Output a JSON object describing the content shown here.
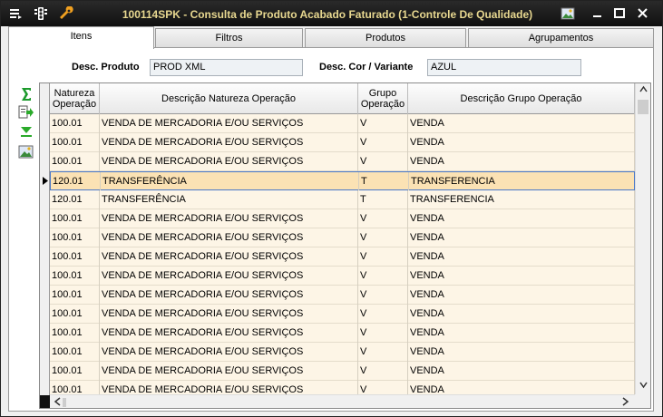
{
  "window": {
    "title": "100114SPK - Consulta de Produto Acabado Faturado (1-Controle De Qualidade)"
  },
  "tabs": [
    {
      "label": "Itens",
      "active": true
    },
    {
      "label": "Filtros",
      "active": false
    },
    {
      "label": "Produtos",
      "active": false
    },
    {
      "label": "Agrupamentos",
      "active": false
    }
  ],
  "filters": {
    "desc_produto_label": "Desc. Produto",
    "desc_produto_value": "PROD XML",
    "desc_cor_label": "Desc. Cor / Variante",
    "desc_cor_value": "AZUL"
  },
  "grid": {
    "columns": [
      "Natureza\nOperação",
      "Descrição Natureza Operação",
      "Grupo\nOperação",
      "Descrição Grupo Operação"
    ],
    "rows": [
      [
        "100.01",
        "VENDA DE MERCADORIA E/OU SERVIÇOS",
        "V",
        "VENDA"
      ],
      [
        "100.01",
        "VENDA DE MERCADORIA E/OU SERVIÇOS",
        "V",
        "VENDA"
      ],
      [
        "100.01",
        "VENDA DE MERCADORIA E/OU SERVIÇOS",
        "V",
        "VENDA"
      ],
      [
        "120.01",
        "TRANSFERÊNCIA",
        "T",
        "TRANSFERENCIA"
      ],
      [
        "120.01",
        "TRANSFERÊNCIA",
        "T",
        "TRANSFERENCIA"
      ],
      [
        "100.01",
        "VENDA DE MERCADORIA E/OU SERVIÇOS",
        "V",
        "VENDA"
      ],
      [
        "100.01",
        "VENDA DE MERCADORIA E/OU SERVIÇOS",
        "V",
        "VENDA"
      ],
      [
        "100.01",
        "VENDA DE MERCADORIA E/OU SERVIÇOS",
        "V",
        "VENDA"
      ],
      [
        "100.01",
        "VENDA DE MERCADORIA E/OU SERVIÇOS",
        "V",
        "VENDA"
      ],
      [
        "100.01",
        "VENDA DE MERCADORIA E/OU SERVIÇOS",
        "V",
        "VENDA"
      ],
      [
        "100.01",
        "VENDA DE MERCADORIA E/OU SERVIÇOS",
        "V",
        "VENDA"
      ],
      [
        "100.01",
        "VENDA DE MERCADORIA E/OU SERVIÇOS",
        "V",
        "VENDA"
      ],
      [
        "100.01",
        "VENDA DE MERCADORIA E/OU SERVIÇOS",
        "V",
        "VENDA"
      ],
      [
        "100.01",
        "VENDA DE MERCADORIA E/OU SERVIÇOS",
        "V",
        "VENDA"
      ],
      [
        "100.01",
        "VENDA DE MERCADORIA E/OU SERVIÇOS",
        "V",
        "VENDA"
      ]
    ],
    "selected_row": 3
  },
  "icons": {
    "titlebar": [
      "menu-icon",
      "traffic-light-icon",
      "wrench-icon",
      "image-icon"
    ],
    "toolbar": [
      "sum-icon",
      "export-icon",
      "filter-down-icon",
      "image-icon"
    ]
  },
  "colors": {
    "row_bg": "#fdf5e6",
    "selected_row_bg": "#fbe2b4",
    "title_text": "#e8d890"
  }
}
